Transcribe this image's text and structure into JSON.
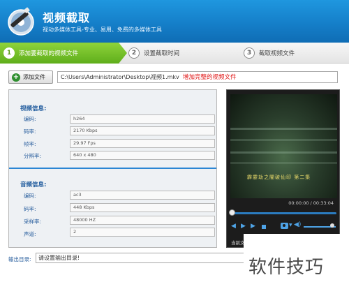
{
  "header": {
    "title": "视频截取",
    "subtitle": "视动多媒体工具-专业、易用、免费的多媒体工具",
    "brand_color": "#157fc9"
  },
  "steps": [
    {
      "number": "1",
      "label": "添加要截取的视频文件",
      "active": true
    },
    {
      "number": "2",
      "label": "设置截取时间",
      "active": false
    },
    {
      "number": "3",
      "label": "截取视频文件",
      "active": false
    }
  ],
  "file_row": {
    "add_button_label": "添加文件",
    "add_icon": "plus-icon",
    "path_value": "C:\\Users\\Administrator\\Desktop\\视频1.mkv",
    "hint": "增加完整的视频文件"
  },
  "video_info": {
    "title": "视频信息:",
    "fields": [
      {
        "label": "编码:",
        "value": "h264"
      },
      {
        "label": "码率:",
        "value": "2170 Kbps"
      },
      {
        "label": "帧率:",
        "value": "29.97 Fps"
      },
      {
        "label": "分辨率:",
        "value": "640 x 480"
      }
    ]
  },
  "audio_info": {
    "title": "音频信息:",
    "fields": [
      {
        "label": "编码:",
        "value": "ac3"
      },
      {
        "label": "码率:",
        "value": "448 Kbps"
      },
      {
        "label": "采样率:",
        "value": "48000 HZ"
      },
      {
        "label": "声道:",
        "value": "2"
      }
    ]
  },
  "player": {
    "caption": "霹靂劫之闇破仙印  第二集",
    "time": "00:00:00 / 00:33:04",
    "progress": 0,
    "volume": 0.9,
    "current_label": "当前文"
  },
  "output": {
    "label": "输出目录:",
    "value": "请设置输出目录!"
  },
  "watermark": "软件技巧"
}
